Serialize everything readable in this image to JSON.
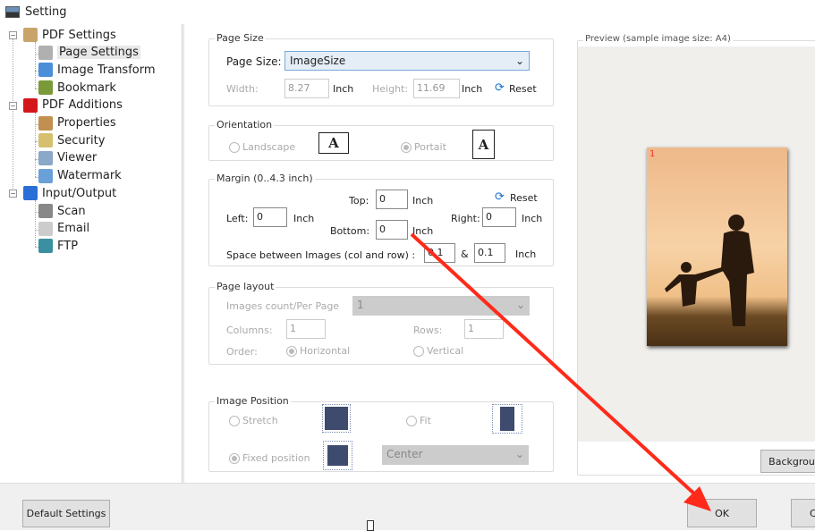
{
  "window": {
    "title": "Setting"
  },
  "tree": [
    {
      "label": "PDF Settings",
      "level": 0
    },
    {
      "label": "Page Settings",
      "level": 1,
      "selected": true
    },
    {
      "label": "Image Transform",
      "level": 1
    },
    {
      "label": "Bookmark",
      "level": 1
    },
    {
      "label": "PDF Additions",
      "level": 0
    },
    {
      "label": "Properties",
      "level": 1
    },
    {
      "label": "Security",
      "level": 1
    },
    {
      "label": "Viewer",
      "level": 1
    },
    {
      "label": "Watermark",
      "level": 1
    },
    {
      "label": "Input/Output",
      "level": 0
    },
    {
      "label": "Scan",
      "level": 1
    },
    {
      "label": "Email",
      "level": 1
    },
    {
      "label": "FTP",
      "level": 1
    }
  ],
  "page_size": {
    "group": "Page Size",
    "label": "Page Size:",
    "value": "ImageSize",
    "width_label": "Width:",
    "width": "8.27",
    "height_label": "Height:",
    "height": "11.69",
    "unit": "Inch",
    "reset": "Reset"
  },
  "orientation": {
    "group": "Orientation",
    "landscape": "Landscape",
    "portrait": "Portait",
    "icon_letter": "A"
  },
  "margin": {
    "group": "Margin (0..4.3 inch)",
    "top_label": "Top:",
    "top": "0",
    "left_label": "Left:",
    "left": "0",
    "right_label": "Right:",
    "right": "0",
    "bottom_label": "Bottom:",
    "bottom": "0",
    "unit": "Inch",
    "reset": "Reset",
    "space_label": "Space between Images (col and row) :",
    "space_col": "0.1",
    "amp": "&",
    "space_row": "0.1"
  },
  "layout": {
    "group": "Page layout",
    "count_label": "Images count/Per Page",
    "count": "1",
    "columns_label": "Columns:",
    "columns": "1",
    "rows_label": "Rows:",
    "rows": "1",
    "order_label": "Order:",
    "horizontal": "Horizontal",
    "vertical": "Vertical"
  },
  "position": {
    "group": "Image Position",
    "stretch": "Stretch",
    "fit": "Fit",
    "fixed": "Fixed position",
    "fixed_value": "Center"
  },
  "preview": {
    "title": "Preview (sample image size: A4)",
    "page_number": "1",
    "background_button": "Backgrou"
  },
  "buttons": {
    "default": "Default Settings",
    "ok": "OK",
    "cancel": "C"
  },
  "colors": {
    "annotation_arrow": "#ff2a1a"
  }
}
